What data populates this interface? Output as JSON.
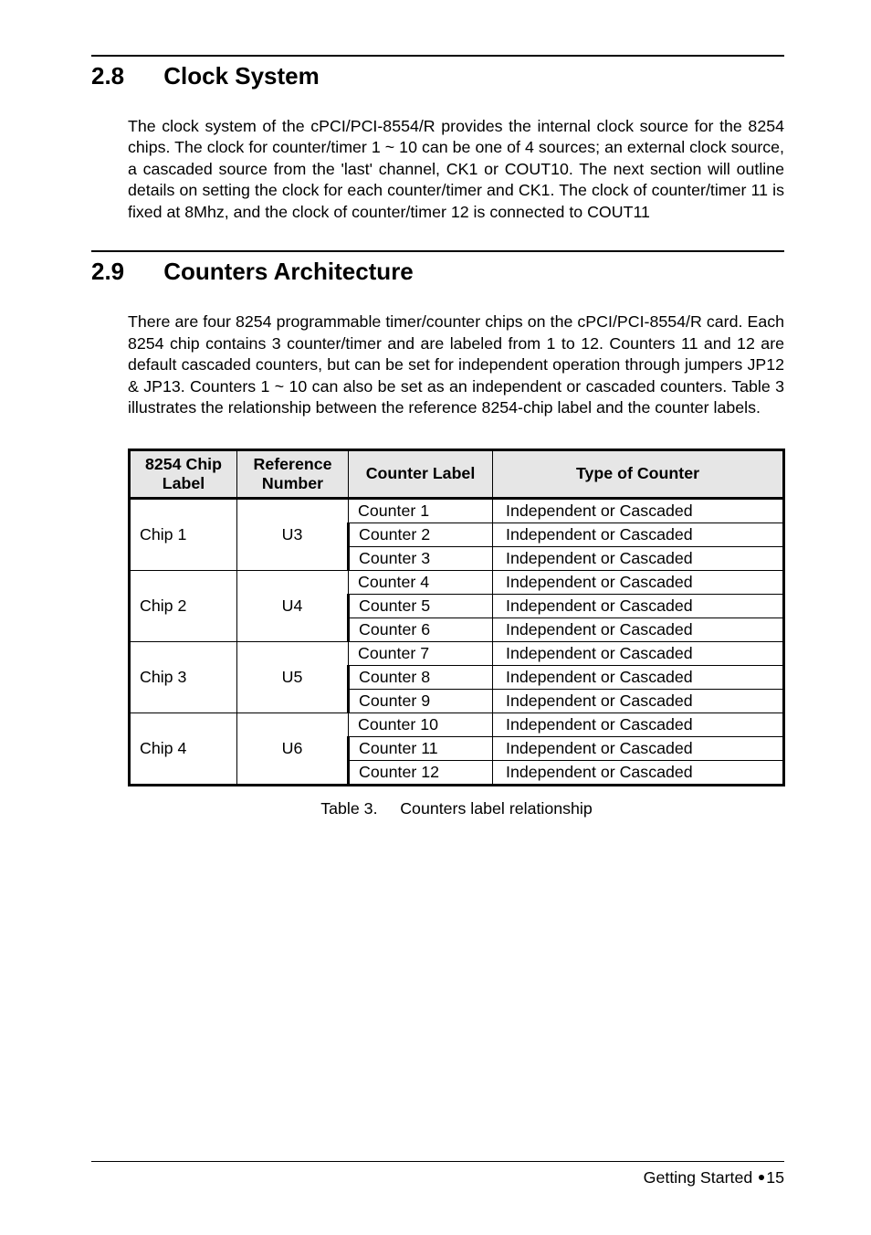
{
  "section1": {
    "number": "2.8",
    "title": "Clock System",
    "body": "The clock system of the cPCI/PCI-8554/R provides the internal clock source for the 8254 chips.  The clock for counter/timer 1 ~ 10 can be one of 4 sources; an external clock source, a cascaded source from the 'last' channel, CK1 or COUT10.  The next section will outline details on setting the clock for each counter/timer and CK1.  The clock of counter/timer 11 is fixed at 8Mhz, and the clock of counter/timer 12 is connected to COUT11"
  },
  "section2": {
    "number": "2.9",
    "title": "Counters Architecture",
    "body": "There are four 8254 programmable timer/counter chips on the cPCI/PCI-8554/R card.  Each 8254 chip contains 3 counter/timer and are labeled from 1 to 12.  Counters 11 and 12 are default cascaded counters, but can be set for independent operation through jumpers JP12 & JP13.  Counters 1 ~ 10 can also be set as an independent or cascaded counters. Table 3 illustrates the relationship between the reference 8254-chip label and the counter labels."
  },
  "table": {
    "headers": {
      "chip": "8254 Chip Label",
      "ref": "Reference Number",
      "counter": "Counter Label",
      "type": "Type of Counter"
    },
    "groups": [
      {
        "chip": "Chip 1",
        "ref": "U3",
        "rows": [
          {
            "counter": "Counter 1",
            "type": "Independent or Cascaded"
          },
          {
            "counter": "Counter 2",
            "type": "Independent or Cascaded"
          },
          {
            "counter": "Counter 3",
            "type": "Independent or Cascaded"
          }
        ]
      },
      {
        "chip": "Chip 2",
        "ref": "U4",
        "rows": [
          {
            "counter": "Counter 4",
            "type": "Independent or Cascaded"
          },
          {
            "counter": "Counter 5",
            "type": "Independent or Cascaded"
          },
          {
            "counter": "Counter 6",
            "type": "Independent or Cascaded"
          }
        ]
      },
      {
        "chip": "Chip 3",
        "ref": "U5",
        "rows": [
          {
            "counter": "Counter 7",
            "type": "Independent or Cascaded"
          },
          {
            "counter": "Counter 8",
            "type": "Independent or Cascaded"
          },
          {
            "counter": "Counter 9",
            "type": "Independent or Cascaded"
          }
        ]
      },
      {
        "chip": "Chip 4",
        "ref": "U6",
        "rows": [
          {
            "counter": "Counter 10",
            "type": "Independent or Cascaded"
          },
          {
            "counter": "Counter 11",
            "type": "Independent or Cascaded"
          },
          {
            "counter": "Counter 12",
            "type": "Independent or Cascaded"
          }
        ]
      }
    ],
    "caption_label": "Table 3.",
    "caption_text": "Counters label relationship"
  },
  "footer": {
    "text": "Getting Started",
    "page": "15"
  }
}
